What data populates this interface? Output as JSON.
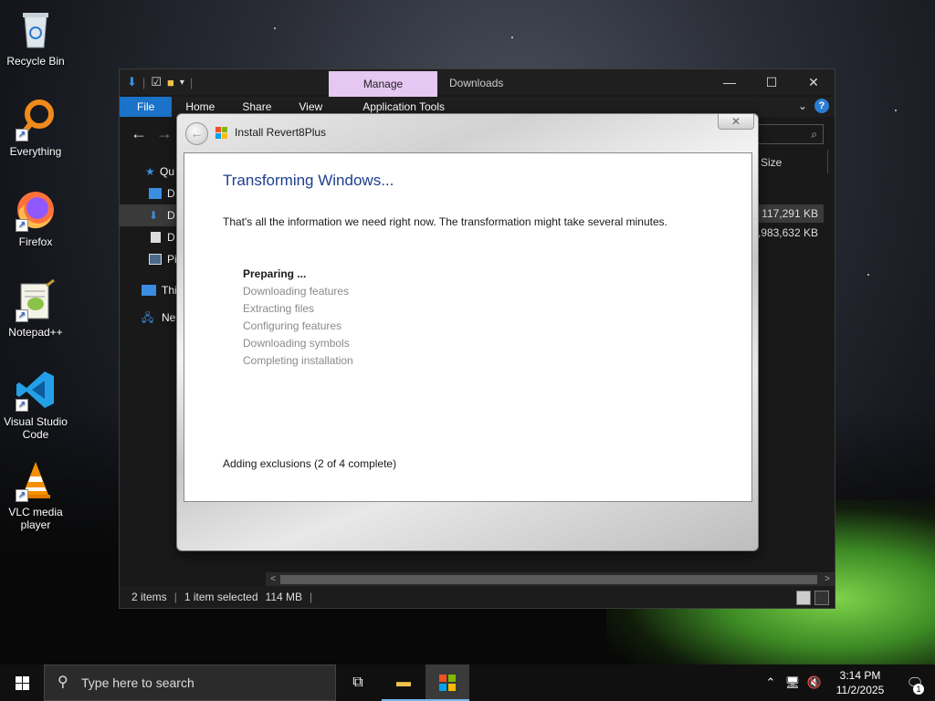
{
  "desktop": {
    "icons": [
      {
        "label": "Recycle Bin",
        "icon": "recycle-bin-icon"
      },
      {
        "label": "Everything",
        "icon": "everything-search-icon"
      },
      {
        "label": "Firefox",
        "icon": "firefox-icon"
      },
      {
        "label": "Notepad++",
        "icon": "notepad-plus-plus-icon"
      },
      {
        "label": "Visual Studio Code",
        "icon": "vscode-icon"
      },
      {
        "label": "VLC media player",
        "icon": "vlc-icon"
      }
    ]
  },
  "explorer": {
    "manage_tab": "Manage",
    "title": "Downloads",
    "ribbon_tabs": [
      "File",
      "Home",
      "Share",
      "View",
      "Application Tools"
    ],
    "tree": [
      {
        "label": "Qu",
        "icon": "quick-access-icon"
      },
      {
        "label": "D",
        "icon": "desktop-folder-icon"
      },
      {
        "label": "D",
        "icon": "downloads-folder-icon",
        "selected": true
      },
      {
        "label": "D",
        "icon": "documents-folder-icon"
      },
      {
        "label": "Pi",
        "icon": "pictures-folder-icon"
      },
      {
        "label": "Thi",
        "icon": "this-pc-icon"
      },
      {
        "label": "Net",
        "icon": "network-icon"
      }
    ],
    "column_size": "Size",
    "sizes": [
      "117,291 KB",
      "2,983,632 KB"
    ],
    "status": {
      "items": "2 items",
      "selected": "1 item selected",
      "size": "114 MB"
    }
  },
  "installer": {
    "window_title": "Install Revert8Plus",
    "heading": "Transforming Windows...",
    "intro": "That's all the information we need right now. The transformation might take several minutes.",
    "steps": [
      {
        "label": "Preparing ...",
        "active": true
      },
      {
        "label": "Downloading features",
        "active": false
      },
      {
        "label": "Extracting files",
        "active": false
      },
      {
        "label": "Configuring features",
        "active": false
      },
      {
        "label": "Downloading symbols",
        "active": false
      },
      {
        "label": "Completing installation",
        "active": false
      }
    ],
    "status": "Adding exclusions (2 of 4 complete)"
  },
  "taskbar": {
    "search_placeholder": "Type here to search",
    "time": "3:14 PM",
    "date": "11/2/2025",
    "notification_count": "1"
  },
  "colors": {
    "accent": "#1a73c8",
    "manage_tab": "#e6c6f2",
    "heading_blue": "#1e3f8c"
  }
}
